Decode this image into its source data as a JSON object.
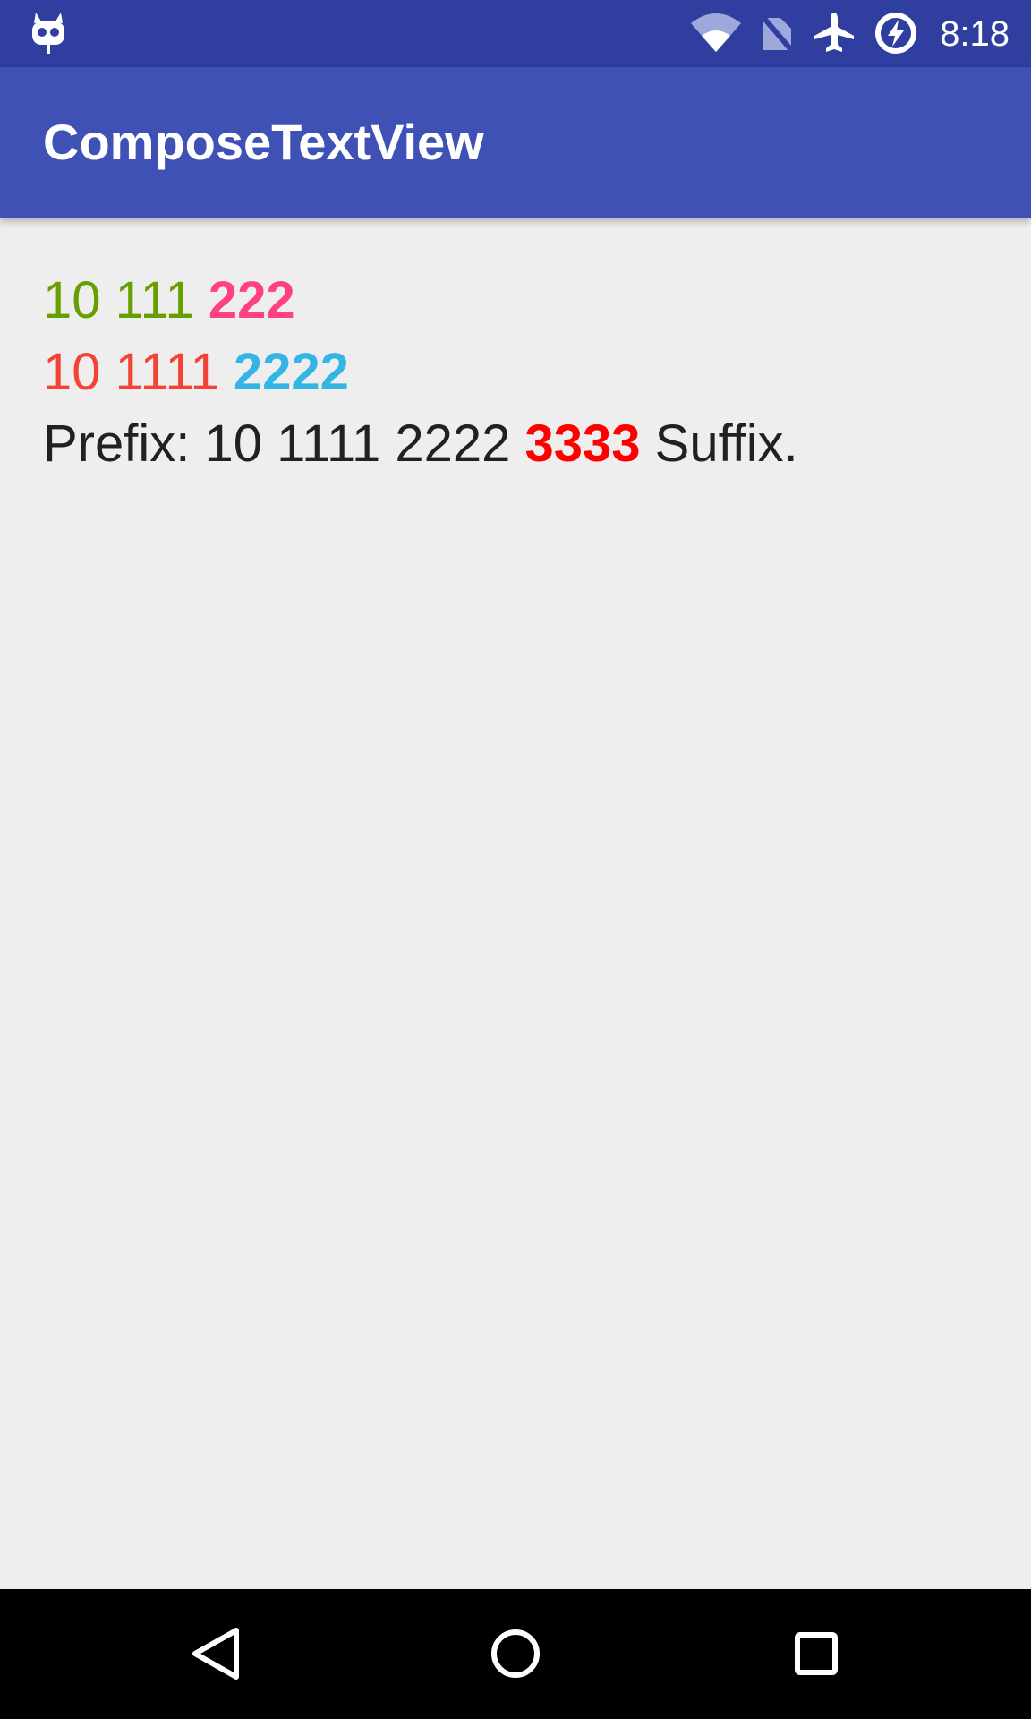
{
  "status_bar": {
    "time": "8:18",
    "icons": [
      "cyanogen-bot-icon",
      "wifi-icon",
      "no-sim-icon",
      "airplane-mode-icon",
      "battery-charging-icon"
    ],
    "color": "#303f9f"
  },
  "app_bar": {
    "title": "ComposeTextView",
    "color": "#3f51b5"
  },
  "content": {
    "line1": {
      "part1": "10 111",
      "part1_color": "#689f00",
      "part2": "222",
      "part2_color": "#ff4081"
    },
    "line2": {
      "part1": "10 1111",
      "part1_color": "#f44336",
      "part2": "2222",
      "part2_color": "#33b5e5"
    },
    "line3": {
      "prefix": "Prefix: 10 1111 2222",
      "highlight": "3333",
      "highlight_color": "#ff0000",
      "suffix": "Suffix."
    }
  },
  "nav_bar": {
    "icons": [
      "back-icon",
      "home-icon",
      "recents-icon"
    ]
  }
}
